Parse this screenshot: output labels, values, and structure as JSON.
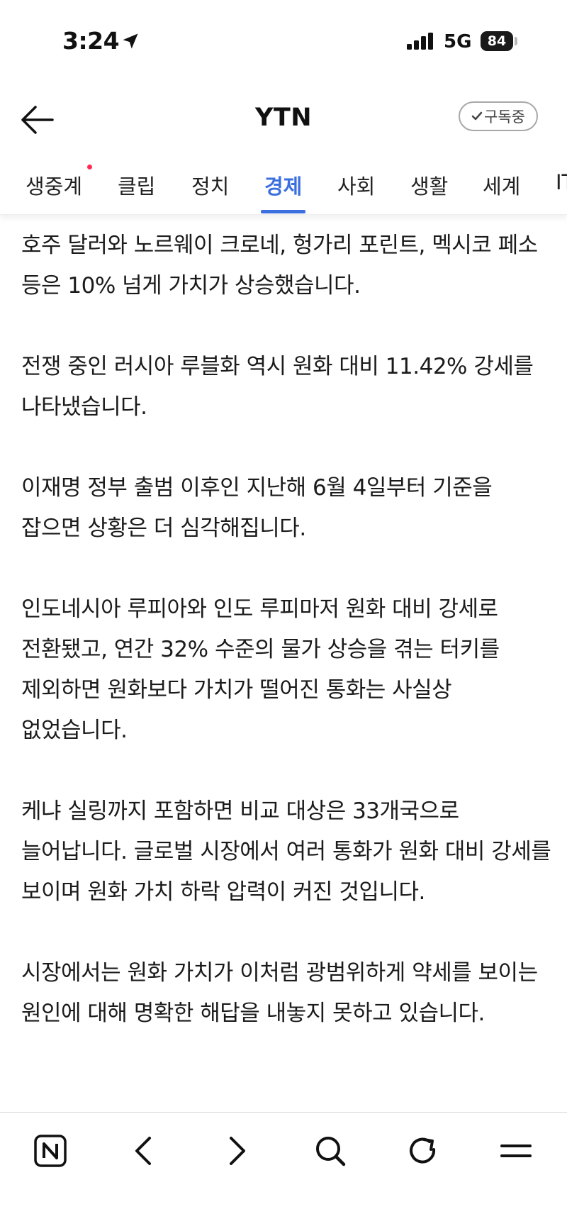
{
  "status_bar": {
    "time": "3:24",
    "network": "5G",
    "battery": "84",
    "icons": [
      "location-arrow-icon",
      "cellular-signal-icon",
      "battery-icon"
    ]
  },
  "nav": {
    "title": "YTN",
    "subscribe_label": "구독중",
    "icons": [
      "back-arrow-icon",
      "checkmark-icon"
    ]
  },
  "tabs": [
    {
      "label": "생중계",
      "has_dot": true
    },
    {
      "label": "클립"
    },
    {
      "label": "정치"
    },
    {
      "label": "경제",
      "active": true
    },
    {
      "label": "사회"
    },
    {
      "label": "생활"
    },
    {
      "label": "세계"
    },
    {
      "label": "IT"
    }
  ],
  "article": {
    "paragraphs": [
      "호주 달러와 노르웨이 크로네, 헝가리 포린트, 멕시코 페소 등은 10% 넘게 가치가 상승했습니다.",
      "전쟁 중인 러시아 루블화 역시 원화 대비 11.42% 강세를 나타냈습니다.",
      "이재명 정부 출범 이후인 지난해 6월 4일부터 기준을 잡으면 상황은 더 심각해집니다.",
      "인도네시아 루피아와 인도 루피마저 원화 대비 강세로 전환됐고, 연간 32% 수준의 물가 상승을 겪는 터키를 제외하면 원화보다 가치가 떨어진 통화는 사실상 없었습니다.",
      "케냐 실링까지 포함하면 비교 대상은 33개국으로 늘어납니다. 글로벌 시장에서 여러 통화가 원화 대비 강세를 보이며 원화 가치 하락 압력이 커진 것입니다.",
      "시장에서는 원화 가치가 이처럼 광범위하게 약세를 보이는 원인에 대해 명확한 해답을 내놓지 못하고 있습니다."
    ]
  },
  "toolbar": {
    "icons": [
      "naver-home-icon",
      "back-chevron-icon",
      "forward-chevron-icon",
      "search-icon",
      "refresh-icon",
      "menu-icon"
    ]
  },
  "colors": {
    "accent": "#3b6fe0",
    "live_dot": "#ff2d55",
    "text": "#1b1b1b"
  }
}
